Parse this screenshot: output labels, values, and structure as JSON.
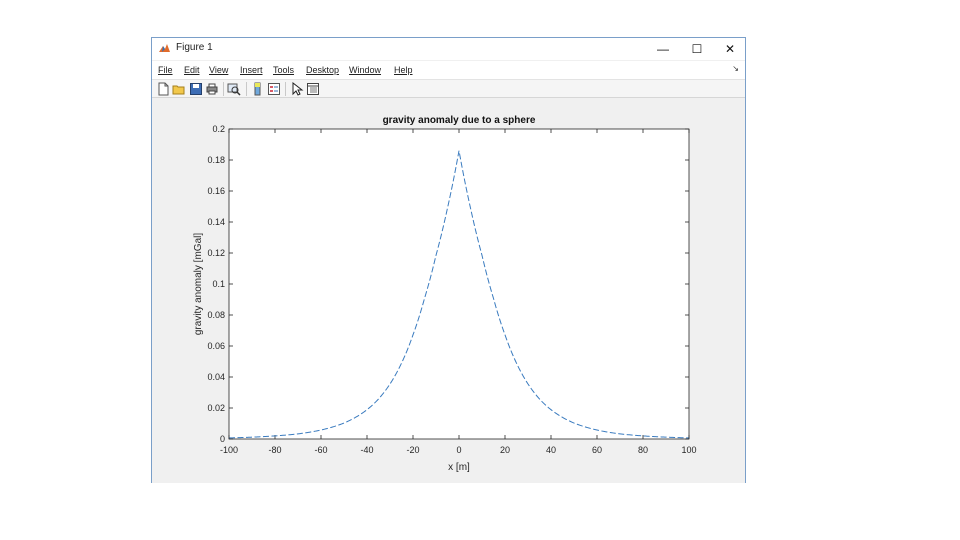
{
  "window": {
    "title": "Figure 1",
    "controls": {
      "minimize": "—",
      "maximize": "☐",
      "close": "✕"
    }
  },
  "menu": {
    "items": [
      "File",
      "Edit",
      "View",
      "Insert",
      "Tools",
      "Desktop",
      "Window",
      "Help"
    ],
    "overflow": "↘"
  },
  "toolbar": {
    "icons": [
      "new-figure-icon",
      "open-file-icon",
      "save-icon",
      "print-icon",
      "zoom-icon",
      "colorbar-icon",
      "legend-icon",
      "pointer-icon",
      "property-editor-icon"
    ]
  },
  "colors": {
    "line": "#3a7bbf",
    "axes": "#262626",
    "figure_bg": "#f0f0f0",
    "axes_bg": "#ffffff"
  },
  "chart_data": {
    "type": "line",
    "title": "gravity anomaly due to a sphere",
    "xlabel": "x [m]",
    "ylabel": "gravity anomaly [mGal]",
    "xlim": [
      -100,
      100
    ],
    "ylim": [
      0,
      0.2
    ],
    "xticks": [
      -100,
      -80,
      -60,
      -40,
      -20,
      0,
      20,
      40,
      60,
      80,
      100
    ],
    "xtick_labels": [
      "-100",
      "-80",
      "-60",
      "-40",
      "-20",
      "0",
      "20",
      "40",
      "60",
      "80",
      "100"
    ],
    "yticks": [
      0,
      0.02,
      0.04,
      0.06,
      0.08,
      0.1,
      0.12,
      0.14,
      0.16,
      0.18,
      0.2
    ],
    "ytick_labels": [
      "0",
      "0.02",
      "0.04",
      "0.06",
      "0.08",
      "0.1",
      "0.12",
      "0.14",
      "0.16",
      "0.18",
      "0.2"
    ],
    "grid": false,
    "line_style": "dashed",
    "series": [
      {
        "x": [
          -100,
          -90,
          -80,
          -70,
          -60,
          -50,
          -40,
          -35,
          -30,
          -25,
          -20,
          -15,
          -10,
          -5,
          0,
          5,
          10,
          15,
          20,
          25,
          30,
          35,
          40,
          50,
          60,
          70,
          80,
          90,
          100
        ],
        "values": [
          0.0007,
          0.0012,
          0.002,
          0.0033,
          0.0058,
          0.0103,
          0.0189,
          0.0258,
          0.0355,
          0.0489,
          0.0672,
          0.0907,
          0.1185,
          0.149,
          0.186,
          0.149,
          0.1185,
          0.0907,
          0.0672,
          0.0489,
          0.0355,
          0.0258,
          0.0189,
          0.0103,
          0.0058,
          0.0033,
          0.002,
          0.0012,
          0.0007
        ]
      }
    ]
  }
}
